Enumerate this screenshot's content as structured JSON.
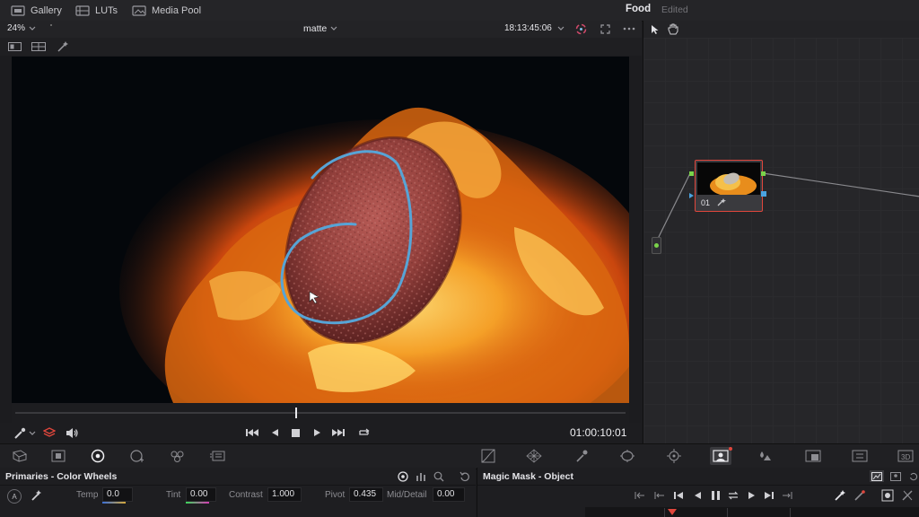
{
  "topbar": {
    "gallery": "Gallery",
    "luts": "LUTs",
    "media_pool": "Media Pool",
    "project_name": "Food",
    "project_status": "Edited"
  },
  "viewer": {
    "zoom": "24%",
    "clip_name": "matte",
    "timecode": "18:13:45:06",
    "playhead_timecode": "01:00:10:01"
  },
  "nodes": {
    "node_label": "01"
  },
  "primaries": {
    "title": "Primaries - Color Wheels",
    "temp_label": "Temp",
    "temp_value": "0.0",
    "tint_label": "Tint",
    "tint_value": "0.00",
    "contrast_label": "Contrast",
    "contrast_value": "1.000",
    "pivot_label": "Pivot",
    "pivot_value": "0.435",
    "mid_label": "Mid/Detail",
    "mid_value": "0.00"
  },
  "magic_mask": {
    "title": "Magic Mask - Object"
  },
  "colors": {
    "accent_red": "#e0463c",
    "stroke_blue": "#57a4d6"
  }
}
